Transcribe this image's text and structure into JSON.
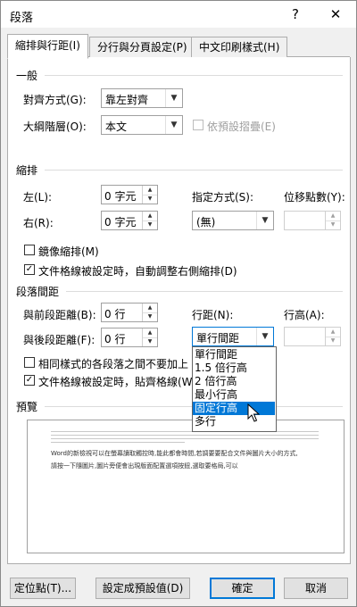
{
  "window": {
    "title": "段落",
    "help_label": "?",
    "close_label": "✕"
  },
  "tabs": [
    {
      "label": "縮排與行距(I)"
    },
    {
      "label": "分行與分頁設定(P)"
    },
    {
      "label": "中文印刷樣式(H)"
    }
  ],
  "general": {
    "section": "一般",
    "alignment_label": "對齊方式(G):",
    "alignment_value": "靠左對齊",
    "outline_label": "大綱階層(O):",
    "outline_value": "本文",
    "collapsed_label": "依預設摺疊(E)"
  },
  "indent": {
    "section": "縮排",
    "left_label": "左(L):",
    "left_value": "0 字元",
    "right_label": "右(R):",
    "right_value": "0 字元",
    "special_label": "指定方式(S):",
    "special_value": "(無)",
    "by_label": "位移點數(Y):",
    "by_value": "",
    "mirror_label": "鏡像縮排(M)",
    "mirror_checked": false,
    "autoadjust_label": "文件格線被設定時，自動調整右側縮排(D)",
    "autoadjust_checked": true
  },
  "spacing": {
    "section": "段落間距",
    "before_label": "與前段距離(B):",
    "before_value": "0 行",
    "after_label": "與後段距離(F):",
    "after_value": "0 行",
    "line_label": "行距(N):",
    "line_value": "單行間距",
    "at_label": "行高(A):",
    "at_value": "",
    "nospace_label": "相同樣式的各段落之間不要加上",
    "nospace_checked": false,
    "snap_label": "文件格線被設定時，貼齊格線(W",
    "snap_checked": true,
    "options": [
      "單行間距",
      "1.5 倍行高",
      "2 倍行高",
      "最小行高",
      "固定行高",
      "多行"
    ],
    "highlighted_option": "固定行高"
  },
  "preview": {
    "section": "預覽",
    "sample_line1": "Word的新檢視可以在螢幕讀取觸控時,能此都會時間,若調要要配合文件與圖片大小的方式,",
    "sample_line2": "請按一下隨圖片,圖片旁便會出現版面配置選項按鈕,選取要格局,可以"
  },
  "buttons": {
    "tabs_label": "定位點(T)...",
    "default_label": "設定成預設值(D)",
    "ok_label": "確定",
    "cancel_label": "取消"
  },
  "colors": {
    "accent": "#0078d7"
  }
}
